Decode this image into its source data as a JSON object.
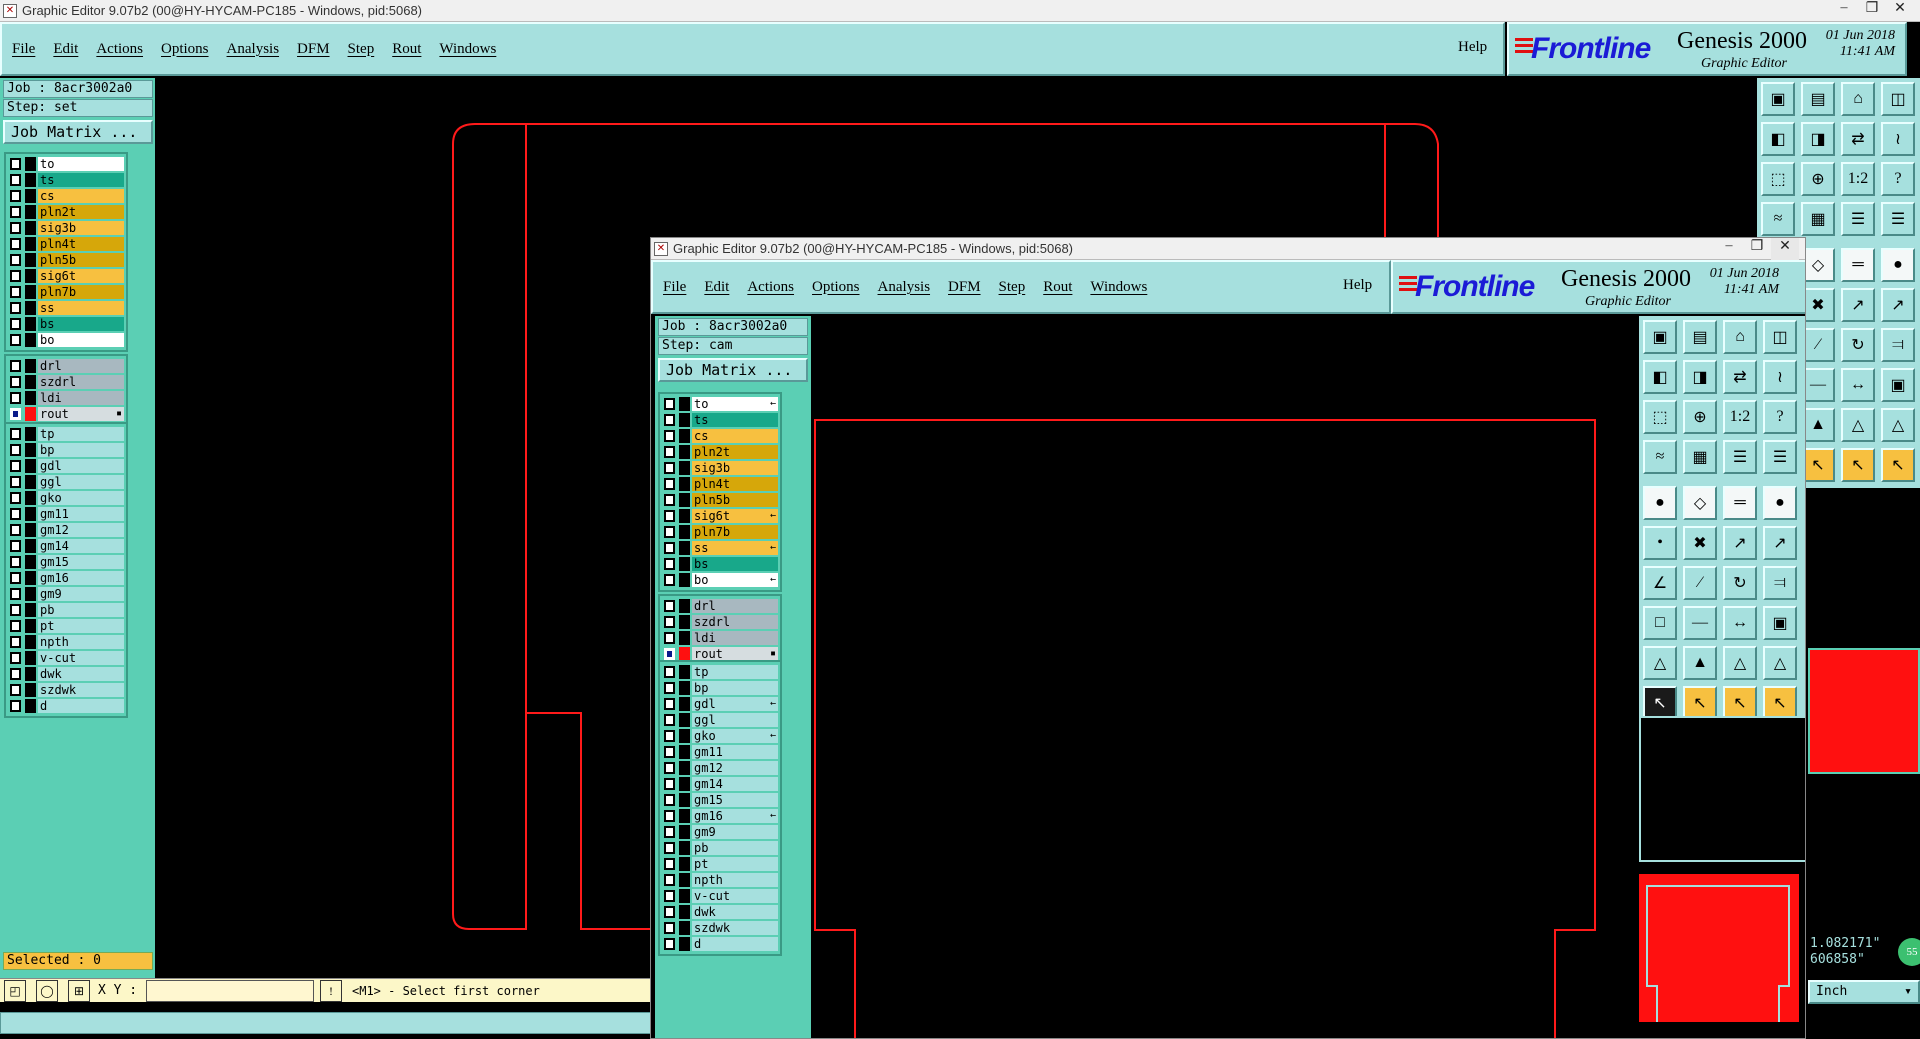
{
  "back_window": {
    "title": "Graphic Editor 9.07b2 (00@HY-HYCAM-PC185 - Windows, pid:5068)",
    "menu": [
      "File",
      "Edit",
      "Actions",
      "Options",
      "Analysis",
      "DFM",
      "Step",
      "Rout",
      "Windows"
    ],
    "help": "Help",
    "job": "Job : 8acr3002a0",
    "step": "Step: set",
    "job_matrix": "Job Matrix ...",
    "selected": "Selected : 0",
    "xy_label": "X Y :",
    "prompt": "<M1> - Select first corner",
    "coord_x": "1.082171\"",
    "coord_y": "606858\"",
    "units": "Inch",
    "badge": "55"
  },
  "front_window": {
    "title": "Graphic Editor 9.07b2 (00@HY-HYCAM-PC185 - Windows, pid:5068)",
    "menu": [
      "File",
      "Edit",
      "Actions",
      "Options",
      "Analysis",
      "DFM",
      "Step",
      "Rout",
      "Windows"
    ],
    "help": "Help",
    "job": "Job : 8acr3002a0",
    "step": "Step: cam",
    "job_matrix": "Job Matrix ..."
  },
  "brand": {
    "logo": "Frontline",
    "product": "Genesis 2000",
    "subtitle": "Graphic Editor",
    "date": "01 Jun 2018",
    "time": "11:41 AM"
  },
  "back_layers": {
    "group1": [
      {
        "name": "to",
        "color": "white"
      },
      {
        "name": "ts",
        "color": "green"
      },
      {
        "name": "cs",
        "color": "orange"
      },
      {
        "name": "pln2t",
        "color": "gold"
      },
      {
        "name": "sig3b",
        "color": "orange"
      },
      {
        "name": "pln4t",
        "color": "gold"
      },
      {
        "name": "pln5b",
        "color": "gold"
      },
      {
        "name": "sig6t",
        "color": "orange"
      },
      {
        "name": "pln7b",
        "color": "gold"
      },
      {
        "name": "ss",
        "color": "orange"
      },
      {
        "name": "bs",
        "color": "green"
      },
      {
        "name": "bo",
        "color": "white"
      }
    ],
    "group2": [
      {
        "name": "drl",
        "color": "gray"
      },
      {
        "name": "szdrl",
        "color": "gray"
      },
      {
        "name": "ldi",
        "color": "gray"
      },
      {
        "name": "rout",
        "color": "ltgray",
        "active": true
      }
    ],
    "group3": [
      "tp",
      "bp",
      "gdl",
      "ggl",
      "gko",
      "gm11",
      "gm12",
      "gm14",
      "gm15",
      "gm16",
      "gm9",
      "pb",
      "pt",
      "npth",
      "v-cut",
      "dwk",
      "szdwk",
      "d"
    ]
  },
  "front_layers": {
    "group1": [
      {
        "name": "to",
        "color": "white",
        "flag": "←"
      },
      {
        "name": "ts",
        "color": "green"
      },
      {
        "name": "cs",
        "color": "orange"
      },
      {
        "name": "pln2t",
        "color": "gold"
      },
      {
        "name": "sig3b",
        "color": "orange"
      },
      {
        "name": "pln4t",
        "color": "gold"
      },
      {
        "name": "pln5b",
        "color": "gold"
      },
      {
        "name": "sig6t",
        "color": "orange",
        "flag": "←"
      },
      {
        "name": "pln7b",
        "color": "gold"
      },
      {
        "name": "ss",
        "color": "orange",
        "flag": "←"
      },
      {
        "name": "bs",
        "color": "green"
      },
      {
        "name": "bo",
        "color": "white",
        "flag": "←"
      }
    ],
    "group2": [
      {
        "name": "drl",
        "color": "gray"
      },
      {
        "name": "szdrl",
        "color": "gray"
      },
      {
        "name": "ldi",
        "color": "gray"
      },
      {
        "name": "rout",
        "color": "ltgray",
        "active": true
      }
    ],
    "group3": [
      {
        "name": "tp"
      },
      {
        "name": "bp"
      },
      {
        "name": "gdl",
        "flag": "←"
      },
      {
        "name": "ggl"
      },
      {
        "name": "gko",
        "flag": "←"
      },
      {
        "name": "gm11"
      },
      {
        "name": "gm12"
      },
      {
        "name": "gm14"
      },
      {
        "name": "gm15"
      },
      {
        "name": "gm16",
        "flag": "←"
      },
      {
        "name": "gm9"
      },
      {
        "name": "pb"
      },
      {
        "name": "pt"
      },
      {
        "name": "npth"
      },
      {
        "name": "v-cut"
      },
      {
        "name": "dwk"
      },
      {
        "name": "szdwk"
      },
      {
        "name": "d"
      }
    ]
  },
  "toolbox_icons": [
    [
      "zoom-home-icon",
      "zoom-out-icon",
      "home-view-icon",
      "split-view-icon"
    ],
    [
      "pan-left-icon",
      "pan-right-icon",
      "redo-view-icon",
      "snap-icon"
    ],
    [
      "fit-icon",
      "center-icon",
      "scale-icon",
      "query-icon"
    ],
    [
      "measure-icon",
      "grid-icon",
      "layers-a-icon",
      "layers-b-icon"
    ],
    [
      "pad-icon",
      "surface-icon",
      "ruler-icon",
      "circle-pad-icon"
    ],
    [
      "nodes-icon",
      "cross-icon",
      "line-node-icon",
      "arc-node-icon"
    ],
    [
      "line-icon",
      "diag-line-icon",
      "arc-icon",
      "mirror-icon"
    ],
    [
      "move-icon",
      "hline-icon",
      "measure2-icon",
      "rect-icon"
    ],
    [
      "tri-icon",
      "tri2-icon",
      "tri3-icon",
      "tri4-icon"
    ],
    [
      "pointer-icon",
      "select-icon",
      "select2-icon",
      "route-icon"
    ]
  ],
  "toolbox_glyphs": [
    [
      "▣",
      "▤",
      "⌂",
      "◫"
    ],
    [
      "◧",
      "◨",
      "⇄",
      "≀"
    ],
    [
      "⬚",
      "⊕",
      "1:2",
      "?"
    ],
    [
      "≈",
      "▦",
      "☰",
      "☰"
    ],
    [
      "●",
      "◇",
      "═",
      "●"
    ],
    [
      "•",
      "✖",
      "↗",
      "↗"
    ],
    [
      "∠",
      "∕",
      "↻",
      "⫤"
    ],
    [
      "□",
      "—",
      "↔",
      "▣"
    ],
    [
      "△",
      "▲",
      "△",
      "△"
    ],
    [
      "↖",
      "↖",
      "↖",
      "↖"
    ]
  ],
  "colors": {
    "panel": "#a6e0de",
    "layer_bg": "#5bcfb4",
    "outline": "#ff1a1a",
    "logo": "#1b1bd6"
  }
}
